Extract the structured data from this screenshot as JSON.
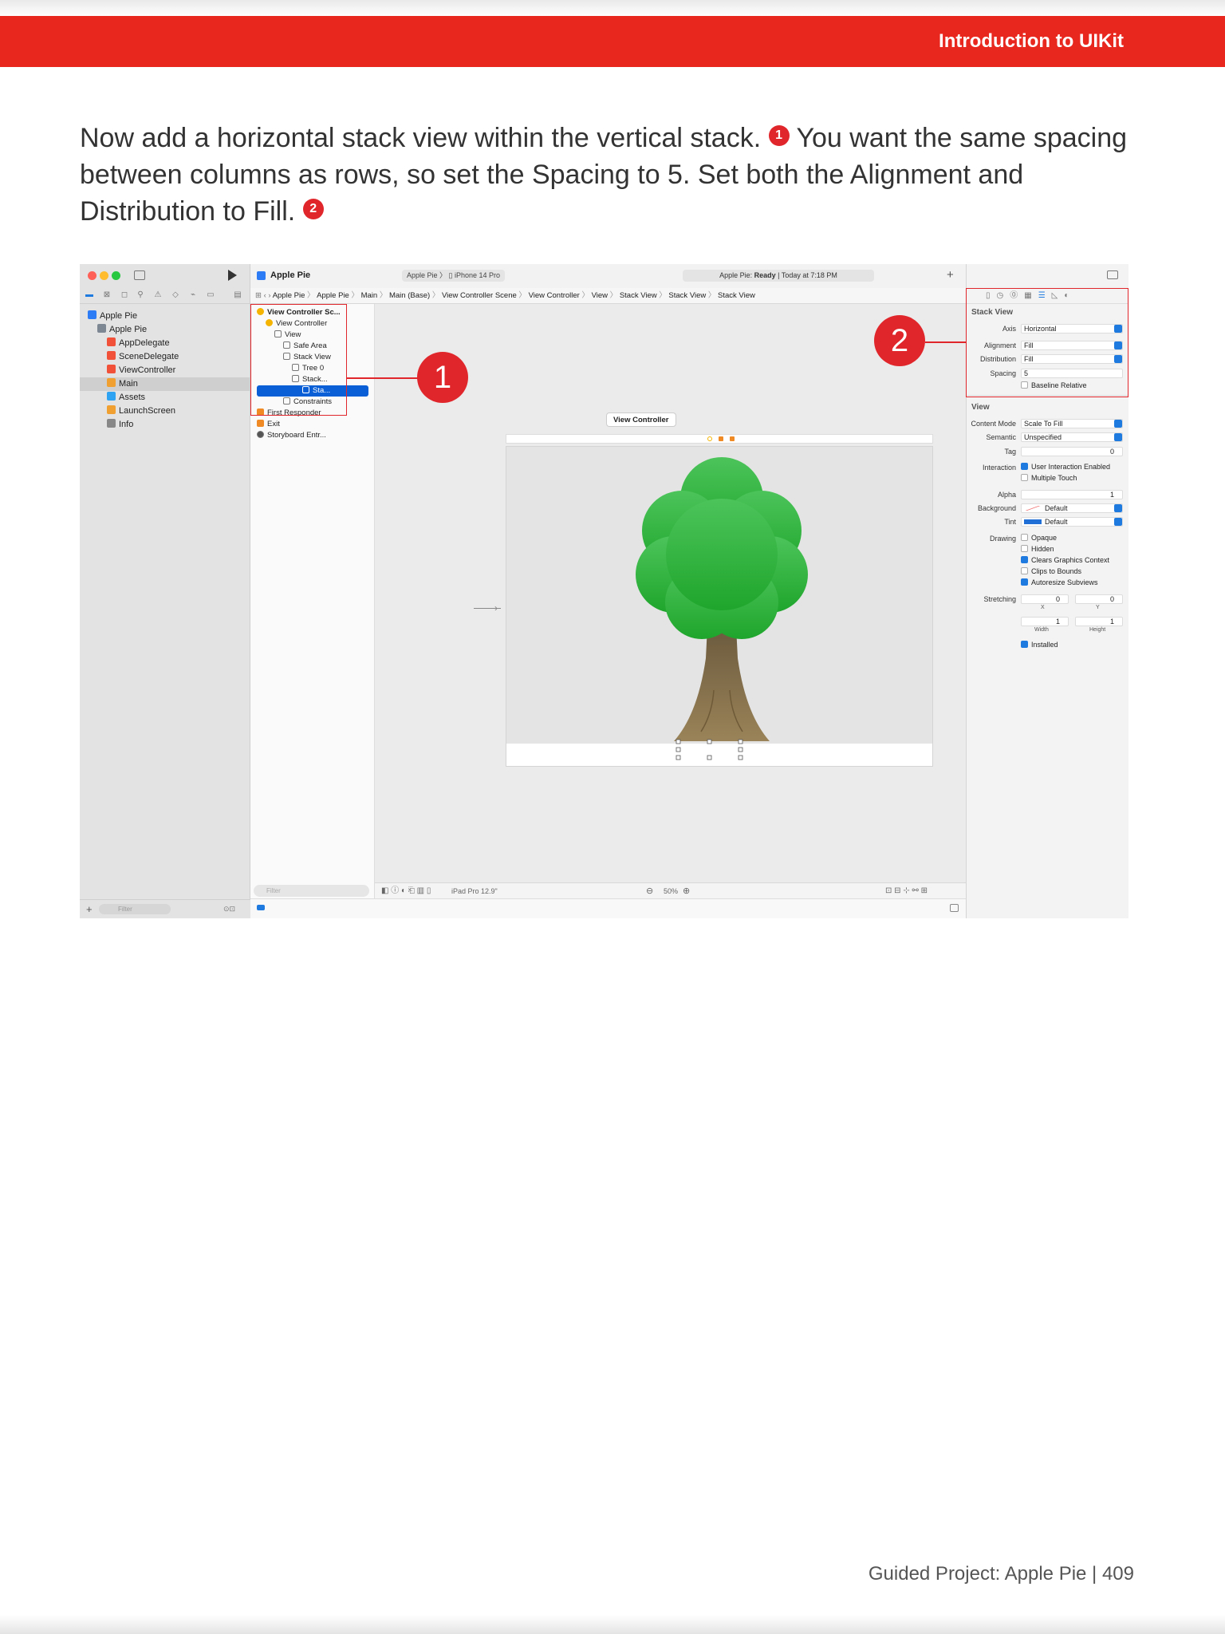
{
  "header": {
    "title": "Introduction to UIKit"
  },
  "intro": {
    "part1": "Now add a horizontal stack view within the vertical stack.",
    "callout1": "1",
    "part2": "You want the same spacing between columns as rows, so set the Spacing to 5. Set both the Alignment and Distribution to Fill.",
    "callout2": "2"
  },
  "xcode": {
    "project_title": "Apple Pie",
    "scheme": "Apple Pie",
    "device": "iPhone 14 Pro",
    "status_app": "Apple Pie:",
    "status_state": "Ready",
    "status_time": "| Today at 7:18 PM",
    "navigator": [
      {
        "label": "Apple Pie",
        "icon": "project-icon",
        "level": 0
      },
      {
        "label": "Apple Pie",
        "icon": "folder-icon",
        "level": 1
      },
      {
        "label": "AppDelegate",
        "icon": "swift-file-icon",
        "level": 2
      },
      {
        "label": "SceneDelegate",
        "icon": "swift-file-icon",
        "level": 2
      },
      {
        "label": "ViewController",
        "icon": "swift-file-icon",
        "level": 2
      },
      {
        "label": "Main",
        "icon": "storyboard-icon",
        "level": 2,
        "selected": true
      },
      {
        "label": "Assets",
        "icon": "assets-icon",
        "level": 2
      },
      {
        "label": "LaunchScreen",
        "icon": "storyboard-icon",
        "level": 2
      },
      {
        "label": "Info",
        "icon": "plist-icon",
        "level": 2
      }
    ],
    "filter_placeholder": "Filter",
    "breadcrumb": [
      "Apple Pie",
      "Apple Pie",
      "Main",
      "Main (Base)",
      "View Controller Scene",
      "View Controller",
      "View",
      "Stack View",
      "Stack View",
      "Stack View"
    ],
    "outline": [
      {
        "label": "View Controller Sc...",
        "level": 0,
        "bold": true
      },
      {
        "label": "View Controller",
        "level": 1
      },
      {
        "label": "View",
        "level": 2
      },
      {
        "label": "Safe Area",
        "level": 3
      },
      {
        "label": "Stack View",
        "level": 3
      },
      {
        "label": "Tree 0",
        "level": 4
      },
      {
        "label": "Stack...",
        "level": 4
      },
      {
        "label": "Sta...",
        "level": 5,
        "selected": true
      },
      {
        "label": "Constraints",
        "level": 3
      },
      {
        "label": "First Responder",
        "level": 0
      },
      {
        "label": "Exit",
        "level": 0
      },
      {
        "label": "Storyboard Entr...",
        "level": 0
      }
    ],
    "outline_filter": "Filter",
    "scene_label": "View Controller",
    "device_config": "iPad Pro 12.9\"",
    "zoom": "50%",
    "inspector": {
      "stack_heading": "Stack View",
      "axis_label": "Axis",
      "axis_value": "Horizontal",
      "alignment_label": "Alignment",
      "alignment_value": "Fill",
      "distribution_label": "Distribution",
      "distribution_value": "Fill",
      "spacing_label": "Spacing",
      "spacing_value": "5",
      "baseline": "Baseline Relative",
      "view_heading": "View",
      "content_mode_label": "Content Mode",
      "content_mode_value": "Scale To Fill",
      "semantic_label": "Semantic",
      "semantic_value": "Unspecified",
      "tag_label": "Tag",
      "tag_value": "0",
      "interaction_label": "Interaction",
      "user_interaction": "User Interaction Enabled",
      "multiple_touch": "Multiple Touch",
      "alpha_label": "Alpha",
      "alpha_value": "1",
      "background_label": "Background",
      "background_value": "Default",
      "tint_label": "Tint",
      "tint_value": "Default",
      "drawing_label": "Drawing",
      "opaque": "Opaque",
      "hidden": "Hidden",
      "clears": "Clears Graphics Context",
      "clips": "Clips to Bounds",
      "autoresize": "Autoresize Subviews",
      "stretching_label": "Stretching",
      "stretch_x": "0",
      "stretch_y": "0",
      "stretch_w": "1",
      "stretch_h": "1",
      "x_label": "X",
      "y_label": "Y",
      "width_label": "Width",
      "height_label": "Height",
      "installed": "Installed"
    },
    "callout_1": "1",
    "callout_2": "2"
  },
  "footer": {
    "text": "Guided Project: Apple Pie  |  409"
  },
  "colors": {
    "header_red": "#e8271f",
    "callout_red": "#e0262b",
    "xcode_blue": "#0a5fd6",
    "tree_green": "#3dbb4a",
    "trunk_brown": "#8c7350"
  }
}
